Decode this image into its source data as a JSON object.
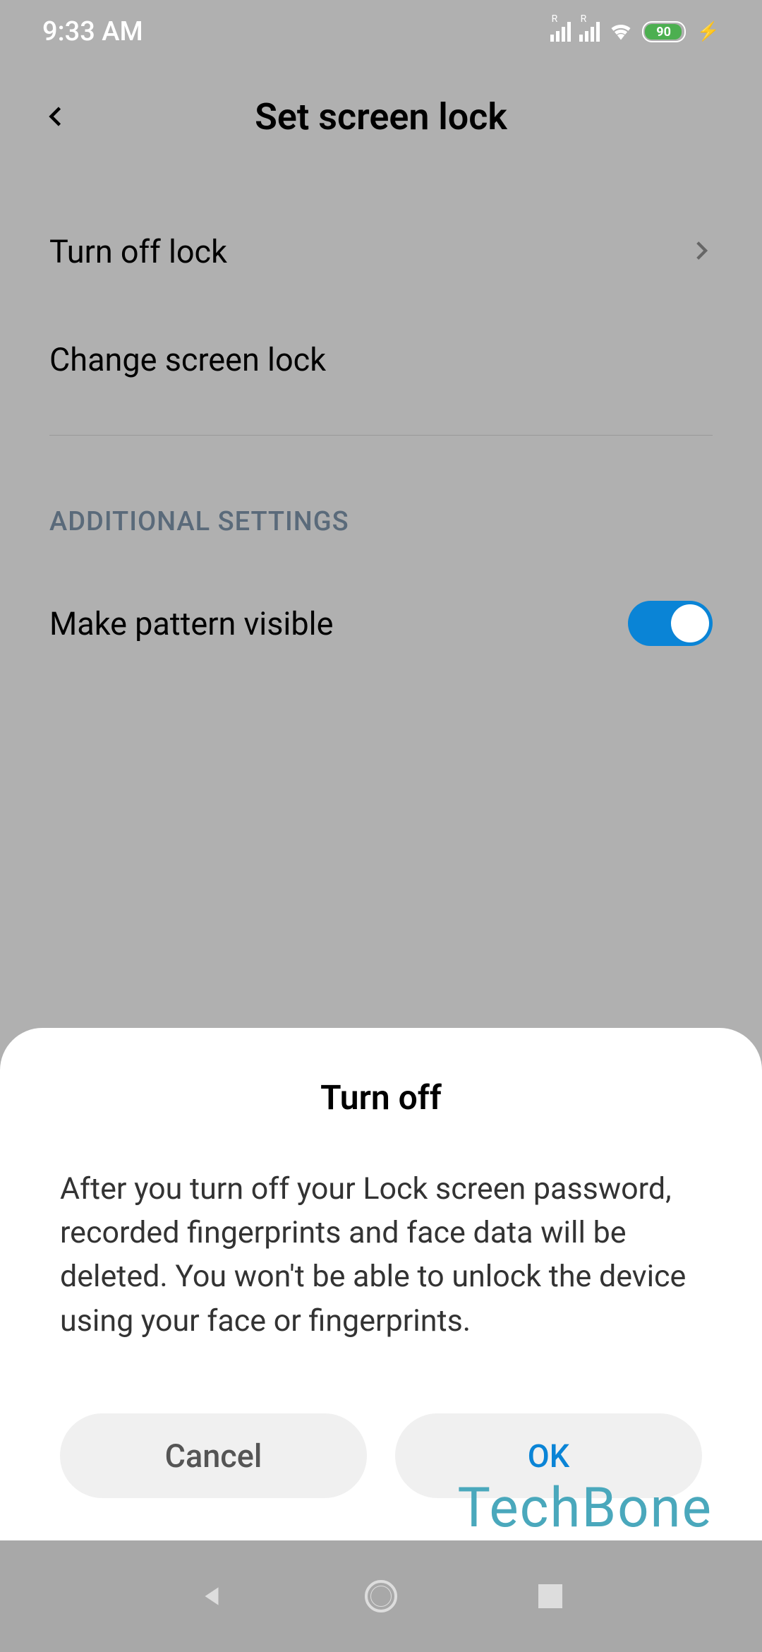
{
  "status": {
    "time": "9:33 AM",
    "battery_pct": "90"
  },
  "header": {
    "title": "Set screen lock"
  },
  "items": {
    "turn_off_lock": "Turn off lock",
    "change_screen_lock": "Change screen lock"
  },
  "section": {
    "additional_settings": "ADDITIONAL SETTINGS",
    "make_pattern_visible": "Make pattern visible"
  },
  "dialog": {
    "title": "Turn off",
    "body": "After you turn off your Lock screen password, recorded fingerprints and face data will be deleted. You won't be able to unlock the device using your face or fingerprints.",
    "cancel": "Cancel",
    "ok": "OK"
  },
  "watermark": "TechBone"
}
